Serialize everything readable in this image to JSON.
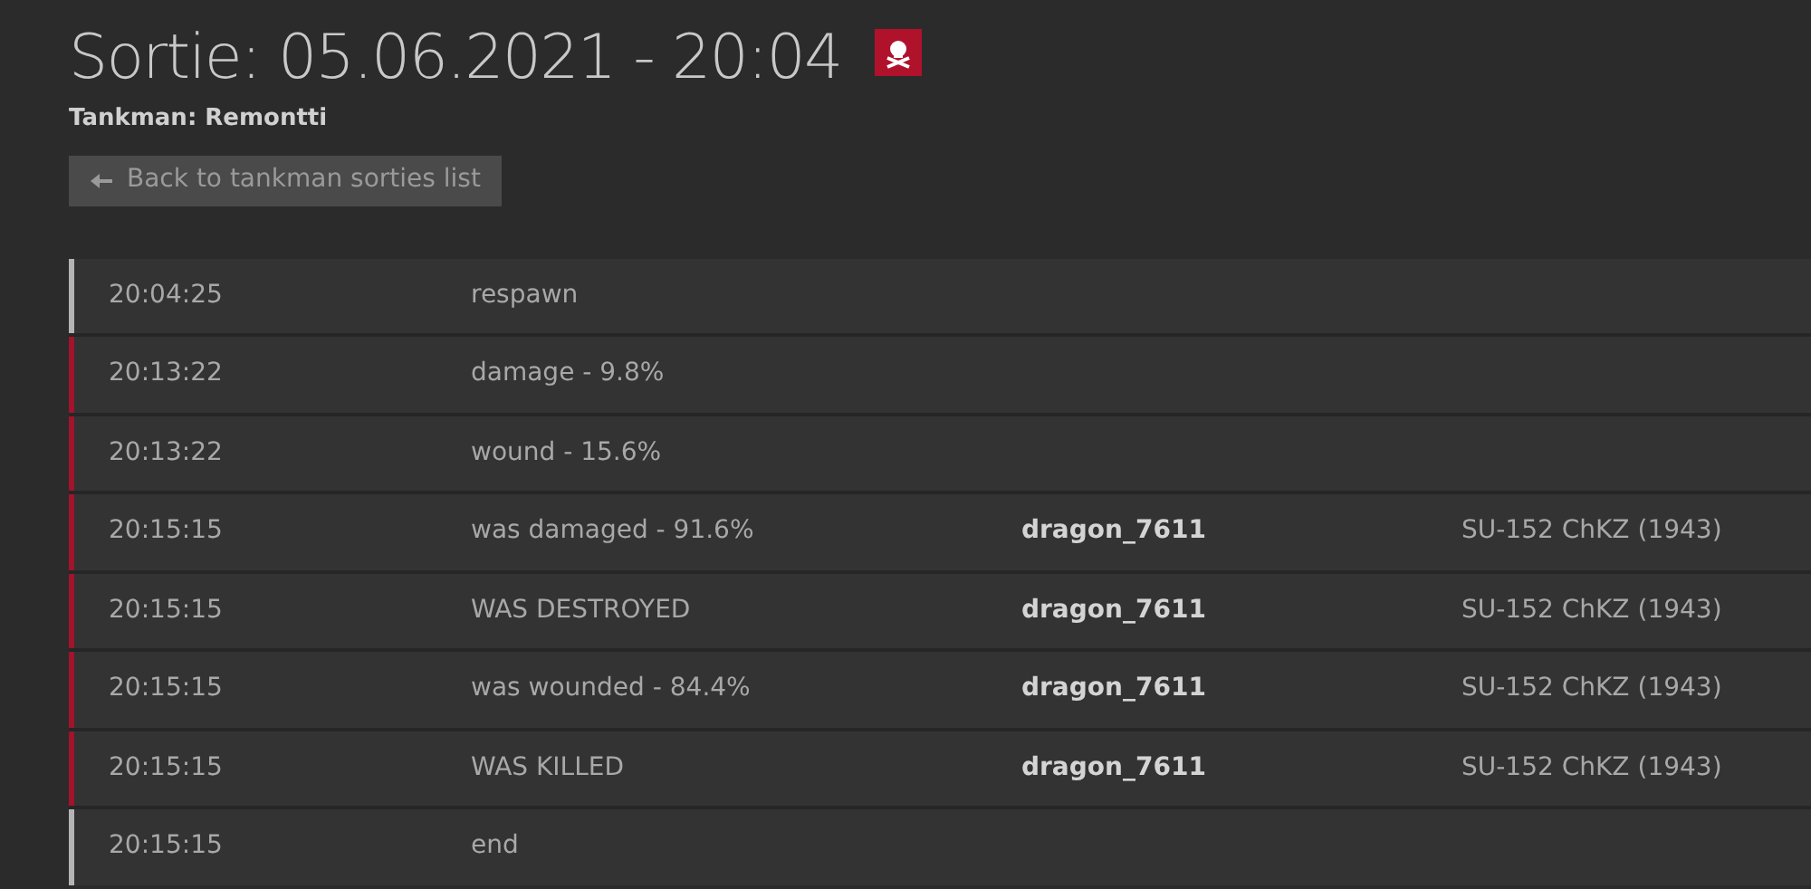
{
  "header": {
    "title": "Sortie: 05.06.2021 - 20:04",
    "subtitle": "Tankman: Remontti",
    "back_button": "Back to tankman sorties list"
  },
  "events": [
    {
      "time": "20:04:25",
      "event": "respawn",
      "color": "#b4b4b4"
    },
    {
      "time": "20:13:22",
      "event": "damage - 9.8%",
      "color": "#a3132b"
    },
    {
      "time": "20:13:22",
      "event": "wound - 15.6%",
      "color": "#a3132b"
    },
    {
      "time": "20:15:15",
      "event": "was damaged - 91.6%",
      "player": "dragon_7611",
      "vehicle": "SU-152 ChKZ (1943)",
      "color": "#a3132b"
    },
    {
      "time": "20:15:15",
      "event": "WAS DESTROYED",
      "player": "dragon_7611",
      "vehicle": "SU-152 ChKZ (1943)",
      "color": "#a3132b"
    },
    {
      "time": "20:15:15",
      "event": "was wounded - 84.4%",
      "player": "dragon_7611",
      "vehicle": "SU-152 ChKZ (1943)",
      "color": "#a3132b"
    },
    {
      "time": "20:15:15",
      "event": "WAS KILLED",
      "player": "dragon_7611",
      "vehicle": "SU-152 ChKZ (1943)",
      "color": "#a3132b"
    },
    {
      "time": "20:15:15",
      "event": "end",
      "color": "#b4b4b4"
    }
  ]
}
